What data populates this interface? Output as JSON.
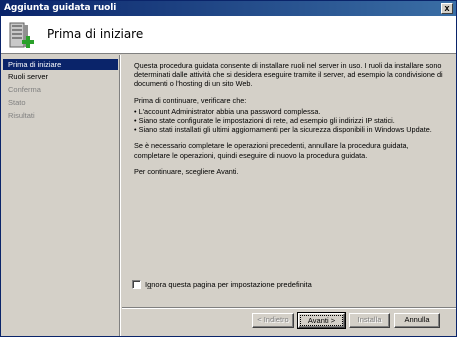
{
  "window": {
    "title": "Aggiunta guidata ruoli",
    "close_glyph": "x"
  },
  "header": {
    "heading": "Prima di iniziare",
    "icon": "server-add-icon"
  },
  "nav": {
    "items": [
      {
        "label": "Prima di iniziare",
        "state": "active"
      },
      {
        "label": "Ruoli server",
        "state": "enabled"
      },
      {
        "label": "Conferma",
        "state": "disabled"
      },
      {
        "label": "Stato",
        "state": "disabled"
      },
      {
        "label": "Risultati",
        "state": "disabled"
      }
    ]
  },
  "content": {
    "intro": "Questa procedura guidata consente di installare ruoli nel server in uso. I ruoli da installare sono determinati dalle attività che si desidera eseguire tramite il server, ad esempio la condivisione di documenti o l'hosting di un sito Web.",
    "before_continue": "Prima di continuare, verificare che:",
    "bullets": [
      "L'account Administrator abbia una password complessa.",
      "Siano state configurate le impostazioni di rete, ad esempio gli indirizzi IP statici.",
      "Siano stati installati gli ultimi aggiornamenti per la sicurezza disponibili in Windows Update."
    ],
    "steps_note": "Se è necessario completare le operazioni precedenti, annullare la procedura guidata, completare le operazioni, quindi eseguire di nuovo la procedura guidata.",
    "continue_note": "Per continuare, scegliere Avanti."
  },
  "checkbox": {
    "label_accel": "g",
    "label_before": "I",
    "label_after": "nora questa pagina per impostazione predefinita",
    "checked": false
  },
  "buttons": {
    "back": "< Indietro",
    "next": "Avanti >",
    "install": "Installa",
    "cancel": "Annulla"
  },
  "colors": {
    "titlebar_start": "#0a246a",
    "titlebar_end": "#3a6ea5",
    "nav_selected": "#0a246a",
    "dialog_face": "#d4d0c8"
  }
}
